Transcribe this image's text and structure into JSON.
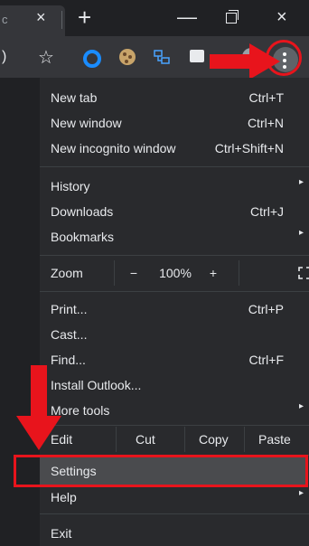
{
  "titlebar": {
    "tab_fragment": "c",
    "close_glyph": "×",
    "new_tab_glyph": "+",
    "minimize_glyph": "—",
    "close_window_glyph": "×"
  },
  "toolbar": {
    "left_fragment": ")",
    "star_glyph": "☆",
    "icons": [
      "bookmark-star-icon",
      "o-extension-icon",
      "cookie-extension-icon",
      "network-extension-icon",
      "red-extension-icon",
      "profile-icon",
      "menu-kebab-icon"
    ]
  },
  "menu": {
    "items": [
      {
        "label": "New tab",
        "shortcut": "Ctrl+T"
      },
      {
        "label": "New window",
        "shortcut": "Ctrl+N"
      },
      {
        "label": "New incognito window",
        "shortcut": "Ctrl+Shift+N"
      },
      {
        "label": "History",
        "shortcut": ""
      },
      {
        "label": "Downloads",
        "shortcut": "Ctrl+J"
      },
      {
        "label": "Bookmarks",
        "shortcut": ""
      },
      {
        "label": "Print...",
        "shortcut": "Ctrl+P"
      },
      {
        "label": "Cast...",
        "shortcut": ""
      },
      {
        "label": "Find...",
        "shortcut": "Ctrl+F"
      },
      {
        "label": "Install Outlook...",
        "shortcut": ""
      },
      {
        "label": "More tools",
        "shortcut": ""
      },
      {
        "label": "Settings",
        "shortcut": ""
      },
      {
        "label": "Help",
        "shortcut": ""
      },
      {
        "label": "Exit",
        "shortcut": ""
      }
    ],
    "zoom": {
      "label": "Zoom",
      "minus": "−",
      "value": "100%",
      "plus": "+"
    },
    "edit": {
      "label": "Edit",
      "cut": "Cut",
      "copy": "Copy",
      "paste": "Paste"
    },
    "submenu_glyph": "▸"
  },
  "colors": {
    "background": "#202124",
    "menu_bg": "#292a2d",
    "highlight": "#4a4b4e",
    "annotation_red": "#e8141c"
  }
}
